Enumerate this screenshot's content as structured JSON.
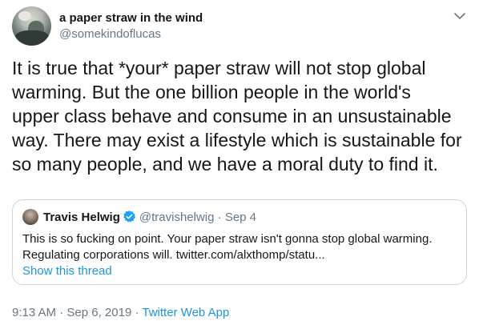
{
  "author": {
    "display_name": "a paper straw in the wind",
    "handle": "@somekindoflucas"
  },
  "tweet": {
    "lines": [
      "It is true that *your* paper straw will not stop global",
      "warming.  But the one billion people in the world's",
      "upper class behave and consume in an unsustainable",
      "way.  There may exist a lifestyle which is sustainable for",
      "so many people, and we have a moral duty to find it."
    ]
  },
  "quoted": {
    "display_name": "Travis Helwig",
    "handle": "@travishelwig",
    "separator": "·",
    "date": "Sep 4",
    "lines": [
      "This is so fucking on point. Your paper straw isn't gonna stop global warming.",
      "Regulating corporations will. twitter.com/alxthomp/statu..."
    ],
    "show_thread": "Show this thread"
  },
  "meta": {
    "time": "9:13 AM",
    "sep1": " · ",
    "date": "Sep 6, 2019",
    "sep2": " · ",
    "app": "Twitter Web App"
  },
  "colors": {
    "link": "#1b95e0",
    "secondary": "#657786",
    "border": "#ccd6dd"
  },
  "icons": {
    "menu": "chevron-down-icon",
    "verified": "verified-badge-icon"
  }
}
